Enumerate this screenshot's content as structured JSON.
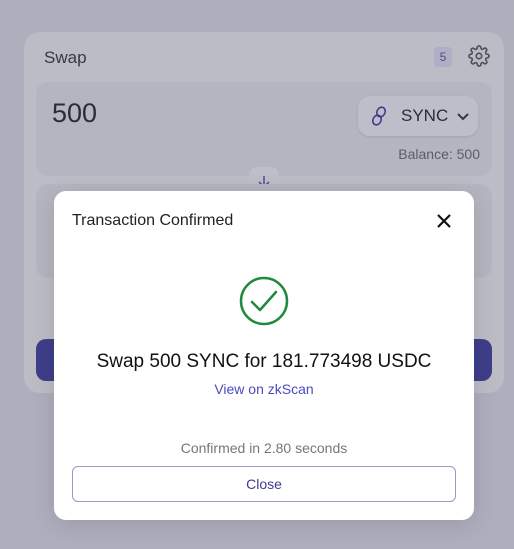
{
  "swap_card": {
    "title": "Swap",
    "badge_count": "5",
    "settings_icon": "gear-icon",
    "from": {
      "amount": "500",
      "token": "SYNC",
      "token_icon": "sync-token-icon",
      "balance": "Balance: 500"
    },
    "switch_icon": "arrow-down-icon"
  },
  "modal": {
    "title": "Transaction Confirmed",
    "close_icon": "close-icon",
    "status_icon": "check-circle-icon",
    "summary": "Swap 500 SYNC for 181.773498 USDC",
    "explorer_link": "View on zkScan",
    "confirmed_text": "Confirmed in 2.80 seconds",
    "close_label": "Close"
  },
  "colors": {
    "accent": "#3c3c9a",
    "success": "#1f8a3e",
    "link": "#4a4ac0"
  }
}
